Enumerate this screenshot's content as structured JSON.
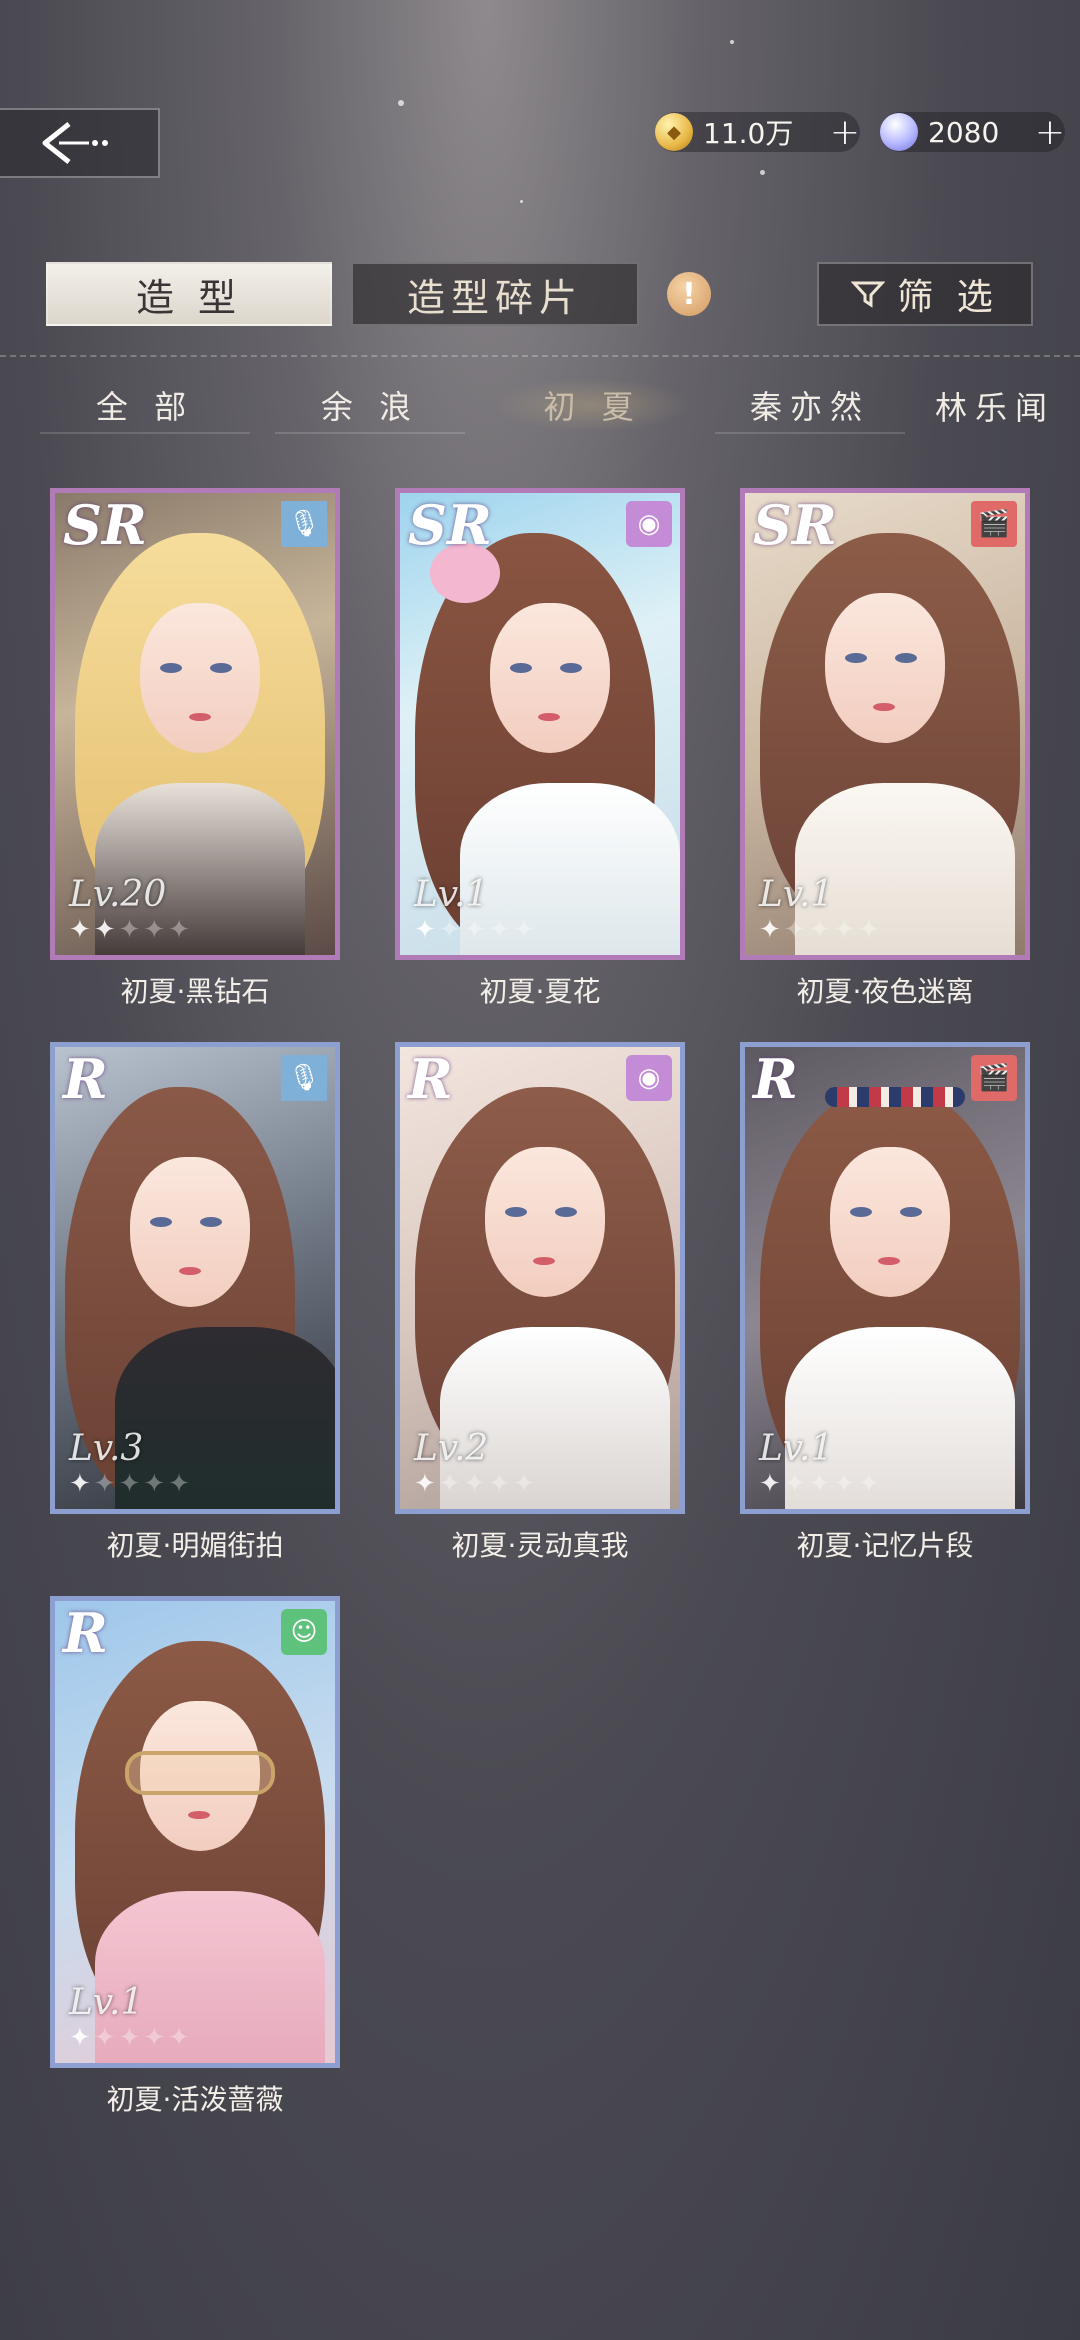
{
  "currencies": {
    "gold": {
      "amount": "11.0万",
      "icon": "coin-icon"
    },
    "diamond": {
      "amount": "2080",
      "icon": "diamond-icon"
    }
  },
  "tabs": {
    "styling": "造 型",
    "fragments": "造型碎片",
    "filter": "筛 选"
  },
  "characters": [
    "全 部",
    "余 浪",
    "初 夏",
    "秦亦然",
    "林乐闻"
  ],
  "active_character": "初 夏",
  "cards": [
    {
      "rarity": "SR",
      "level": "Lv.20",
      "name": "初夏·黑钻石",
      "badge": "microphone-icon",
      "badge_color": "#7fb0d8"
    },
    {
      "rarity": "SR",
      "level": "Lv.1",
      "name": "初夏·夏花",
      "badge": "camera-lens-icon",
      "badge_color": "#c48bd6"
    },
    {
      "rarity": "SR",
      "level": "Lv.1",
      "name": "初夏·夜色迷离",
      "badge": "clapperboard-icon",
      "badge_color": "#e06a68"
    },
    {
      "rarity": "R",
      "level": "Lv.3",
      "name": "初夏·明媚街拍",
      "badge": "microphone-icon",
      "badge_color": "#7fb0d8"
    },
    {
      "rarity": "R",
      "level": "Lv.2",
      "name": "初夏·灵动真我",
      "badge": "camera-lens-icon",
      "badge_color": "#c48bd6"
    },
    {
      "rarity": "R",
      "level": "Lv.1",
      "name": "初夏·记忆片段",
      "badge": "clapperboard-icon",
      "badge_color": "#e06a68"
    },
    {
      "rarity": "R",
      "level": "Lv.1",
      "name": "初夏·活泼蔷薇",
      "badge": "smiley-icon",
      "badge_color": "#5fc27c"
    }
  ]
}
